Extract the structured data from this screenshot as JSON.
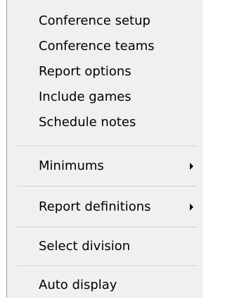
{
  "menu": {
    "items": [
      {
        "label": "Conference setup"
      },
      {
        "label": "Conference teams"
      },
      {
        "label": "Report options"
      },
      {
        "label": "Include games"
      },
      {
        "label": "Schedule notes"
      },
      {
        "label": "Minimums",
        "submenu": true,
        "submenu_icon": "chevron-right-icon"
      },
      {
        "label": "Report definitions",
        "submenu": true,
        "submenu_icon": "chevron-right-icon"
      },
      {
        "label": "Select division"
      },
      {
        "label": "Auto display"
      }
    ]
  }
}
